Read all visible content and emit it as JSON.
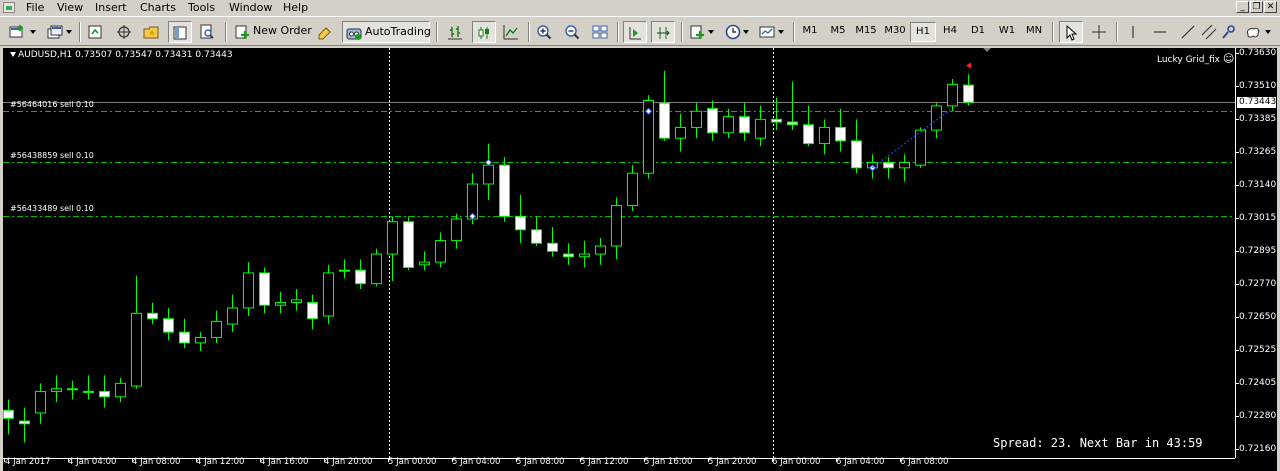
{
  "menubar": {
    "items": [
      "File",
      "View",
      "Insert",
      "Charts",
      "Tools",
      "Window",
      "Help"
    ],
    "window_buttons": [
      "_",
      "❐",
      "✕"
    ]
  },
  "toolbar": {
    "new_order_label": "New Order",
    "autotrading_label": "AutoTrading",
    "timeframes": [
      "M1",
      "M5",
      "M15",
      "M30",
      "H1",
      "H4",
      "D1",
      "W1",
      "MN"
    ],
    "active_timeframe": "H1"
  },
  "chart": {
    "title": "AUDUSD,H1  0.73507 0.73547 0.73431 0.73443",
    "ea_label": "Lucky Grid_fix",
    "spread_text": "Spread: 23. Next Bar in 43:59",
    "current_price": "0.73443",
    "price_labels": [
      "0.73630",
      "0.73510",
      "0.73385",
      "0.73265",
      "0.73140",
      "0.73015",
      "0.72895",
      "0.72770",
      "0.72650",
      "0.72525",
      "0.72405",
      "0.72280",
      "0.72160"
    ],
    "time_labels": [
      "4 Jan 2017",
      "4 Jan 04:00",
      "4 Jan 08:00",
      "4 Jan 12:00",
      "4 Jan 16:00",
      "4 Jan 20:00",
      "5 Jan 00:00",
      "5 Jan 04:00",
      "5 Jan 08:00",
      "5 Jan 12:00",
      "5 Jan 16:00",
      "5 Jan 20:00",
      "6 Jan 00:00",
      "6 Jan 04:00",
      "6 Jan 08:00"
    ],
    "orders": [
      {
        "label": "#56464016 sell 0.10",
        "price": 0.7341
      },
      {
        "label": "#56438859 sell 0.10",
        "price": 0.7322
      },
      {
        "label": "#56433489 sell 0.10",
        "price": 0.7302
      }
    ],
    "colors": {
      "background": "#000000",
      "bull_body": "#000000",
      "bear_body": "#ffffff",
      "wick": "#00ff00",
      "grid": "#ffffff",
      "order_line": "#00c000",
      "marker": "#3050ff"
    }
  },
  "chart_data": {
    "type": "candlestick",
    "symbol": "AUDUSD",
    "timeframe": "H1",
    "ylim": [
      0.7216,
      0.7363
    ],
    "ohlc_last": [
      0.73507,
      0.73547,
      0.73431,
      0.73443
    ],
    "candles": [
      [
        0.723,
        0.7234,
        0.7221,
        0.7227
      ],
      [
        0.7226,
        0.7231,
        0.7218,
        0.7225
      ],
      [
        0.7229,
        0.724,
        0.7225,
        0.7237
      ],
      [
        0.7237,
        0.7243,
        0.7233,
        0.7238
      ],
      [
        0.7238,
        0.7241,
        0.7234,
        0.7238
      ],
      [
        0.7237,
        0.7243,
        0.7234,
        0.7237
      ],
      [
        0.7237,
        0.7243,
        0.7231,
        0.7235
      ],
      [
        0.7235,
        0.7242,
        0.7233,
        0.724
      ],
      [
        0.7239,
        0.728,
        0.7238,
        0.7266
      ],
      [
        0.7266,
        0.727,
        0.7262,
        0.7264
      ],
      [
        0.7264,
        0.7268,
        0.7256,
        0.7259
      ],
      [
        0.7259,
        0.7264,
        0.7253,
        0.7255
      ],
      [
        0.7255,
        0.7259,
        0.7252,
        0.7257
      ],
      [
        0.7257,
        0.7267,
        0.7255,
        0.7263
      ],
      [
        0.7262,
        0.7273,
        0.7259,
        0.7268
      ],
      [
        0.7268,
        0.7285,
        0.7265,
        0.7281
      ],
      [
        0.7281,
        0.7283,
        0.7266,
        0.7269
      ],
      [
        0.7269,
        0.7274,
        0.7266,
        0.727
      ],
      [
        0.727,
        0.7275,
        0.7267,
        0.7271
      ],
      [
        0.727,
        0.7273,
        0.726,
        0.7264
      ],
      [
        0.7265,
        0.7284,
        0.7262,
        0.7281
      ],
      [
        0.7282,
        0.7286,
        0.7279,
        0.7282
      ],
      [
        0.7282,
        0.7286,
        0.7275,
        0.7277
      ],
      [
        0.7277,
        0.729,
        0.7276,
        0.7288
      ],
      [
        0.7288,
        0.7302,
        0.7278,
        0.73
      ],
      [
        0.73,
        0.7302,
        0.7282,
        0.7283
      ],
      [
        0.7284,
        0.7289,
        0.7282,
        0.7285
      ],
      [
        0.7285,
        0.7296,
        0.7283,
        0.7293
      ],
      [
        0.7293,
        0.7303,
        0.729,
        0.7301
      ],
      [
        0.7301,
        0.7318,
        0.7299,
        0.7314
      ],
      [
        0.7314,
        0.7329,
        0.7308,
        0.7321
      ],
      [
        0.7321,
        0.7324,
        0.73,
        0.7302
      ],
      [
        0.7302,
        0.731,
        0.7292,
        0.7297
      ],
      [
        0.7297,
        0.7302,
        0.7291,
        0.7292
      ],
      [
        0.7292,
        0.7298,
        0.7287,
        0.7289
      ],
      [
        0.7288,
        0.7292,
        0.7284,
        0.7287
      ],
      [
        0.7287,
        0.7293,
        0.7283,
        0.7288
      ],
      [
        0.7288,
        0.7294,
        0.7284,
        0.7291
      ],
      [
        0.7291,
        0.7309,
        0.7286,
        0.7306
      ],
      [
        0.7306,
        0.7321,
        0.7304,
        0.7318
      ],
      [
        0.7318,
        0.7347,
        0.7316,
        0.7345
      ],
      [
        0.7344,
        0.7356,
        0.733,
        0.7331
      ],
      [
        0.7331,
        0.734,
        0.7326,
        0.7335
      ],
      [
        0.7335,
        0.7344,
        0.7331,
        0.7341
      ],
      [
        0.7342,
        0.7345,
        0.733,
        0.7333
      ],
      [
        0.7333,
        0.7342,
        0.7331,
        0.7339
      ],
      [
        0.7339,
        0.7344,
        0.733,
        0.7333
      ],
      [
        0.7331,
        0.7343,
        0.7328,
        0.7338
      ],
      [
        0.7338,
        0.7346,
        0.7334,
        0.7337
      ],
      [
        0.7337,
        0.7352,
        0.7334,
        0.7336
      ],
      [
        0.7336,
        0.7343,
        0.7328,
        0.7329
      ],
      [
        0.7329,
        0.7338,
        0.7325,
        0.7335
      ],
      [
        0.7335,
        0.7342,
        0.7326,
        0.733
      ],
      [
        0.733,
        0.7338,
        0.7318,
        0.732
      ],
      [
        0.732,
        0.7325,
        0.7316,
        0.7322
      ],
      [
        0.7322,
        0.7324,
        0.7316,
        0.732
      ],
      [
        0.732,
        0.7325,
        0.7315,
        0.7322
      ],
      [
        0.7321,
        0.7335,
        0.732,
        0.7334
      ],
      [
        0.7334,
        0.7344,
        0.7331,
        0.7343
      ],
      [
        0.7343,
        0.7353,
        0.7341,
        0.7351
      ],
      [
        0.73507,
        0.73547,
        0.73431,
        0.73443
      ]
    ],
    "first_time_label": "4 Jan 2017",
    "time_label_step_hours": 4
  }
}
